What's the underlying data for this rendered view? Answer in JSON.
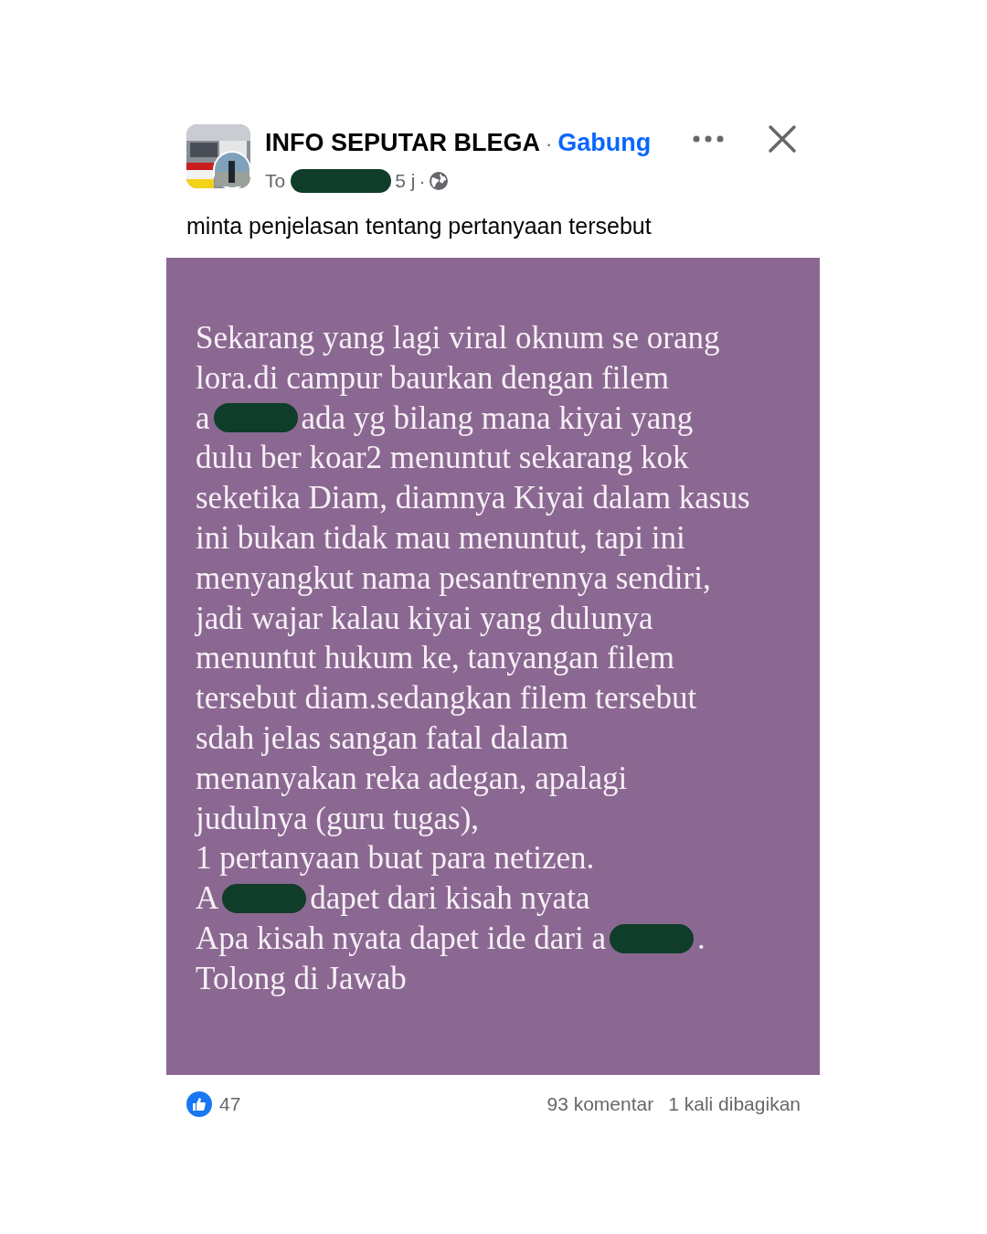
{
  "post": {
    "group_name": "INFO SEPUTAR BLEGA",
    "separator": "·",
    "join_label": "Gabung",
    "author_line": [
      {
        "kind": "text",
        "text": "To"
      },
      {
        "kind": "redaction"
      },
      {
        "kind": "text",
        "text": "5 j"
      },
      {
        "kind": "text",
        "text": "·"
      },
      {
        "kind": "globe"
      }
    ],
    "caption": "minta penjelasan tentang pertanyaan tersebut",
    "image_lines": [
      [
        {
          "kind": "text",
          "text": "Sekarang yang lagi viral oknum se orang"
        }
      ],
      [
        {
          "kind": "text",
          "text": "lora.di campur baurkan dengan filem"
        }
      ],
      [
        {
          "kind": "text",
          "text": "a"
        },
        {
          "kind": "redaction"
        },
        {
          "kind": "text",
          "text": "ada yg bilang mana kiyai yang"
        }
      ],
      [
        {
          "kind": "text",
          "text": "dulu ber koar2 menuntut sekarang kok"
        }
      ],
      [
        {
          "kind": "text",
          "text": "seketika Diam, diamnya Kiyai dalam kasus"
        }
      ],
      [
        {
          "kind": "text",
          "text": "ini bukan tidak mau menuntut, tapi ini"
        }
      ],
      [
        {
          "kind": "text",
          "text": "menyangkut nama pesantrennya sendiri,"
        }
      ],
      [
        {
          "kind": "text",
          "text": "jadi wajar kalau kiyai yang dulunya"
        }
      ],
      [
        {
          "kind": "text",
          "text": "menuntut hukum ke, tanyangan filem"
        }
      ],
      [
        {
          "kind": "text",
          "text": "tersebut diam.sedangkan filem tersebut"
        }
      ],
      [
        {
          "kind": "text",
          "text": "sdah jelas sangan fatal dalam"
        }
      ],
      [
        {
          "kind": "text",
          "text": "menanyakan reka adegan, apalagi"
        }
      ],
      [
        {
          "kind": "text",
          "text": "judulnya (guru tugas),"
        }
      ],
      [
        {
          "kind": "text",
          "text": "1 pertanyaan buat para netizen."
        }
      ],
      [
        {
          "kind": "text",
          "text": "A"
        },
        {
          "kind": "redaction"
        },
        {
          "kind": "text",
          "text": "dapet dari kisah nyata"
        }
      ],
      [
        {
          "kind": "text",
          "text": "Apa kisah nyata dapet ide dari a"
        },
        {
          "kind": "redaction"
        },
        {
          "kind": "text",
          "text": "."
        }
      ],
      [
        {
          "kind": "text",
          "text": "Tolong di Jawab"
        }
      ]
    ],
    "likes": "47",
    "comments": "93 komentar",
    "shares": "1 kali dibagikan"
  }
}
